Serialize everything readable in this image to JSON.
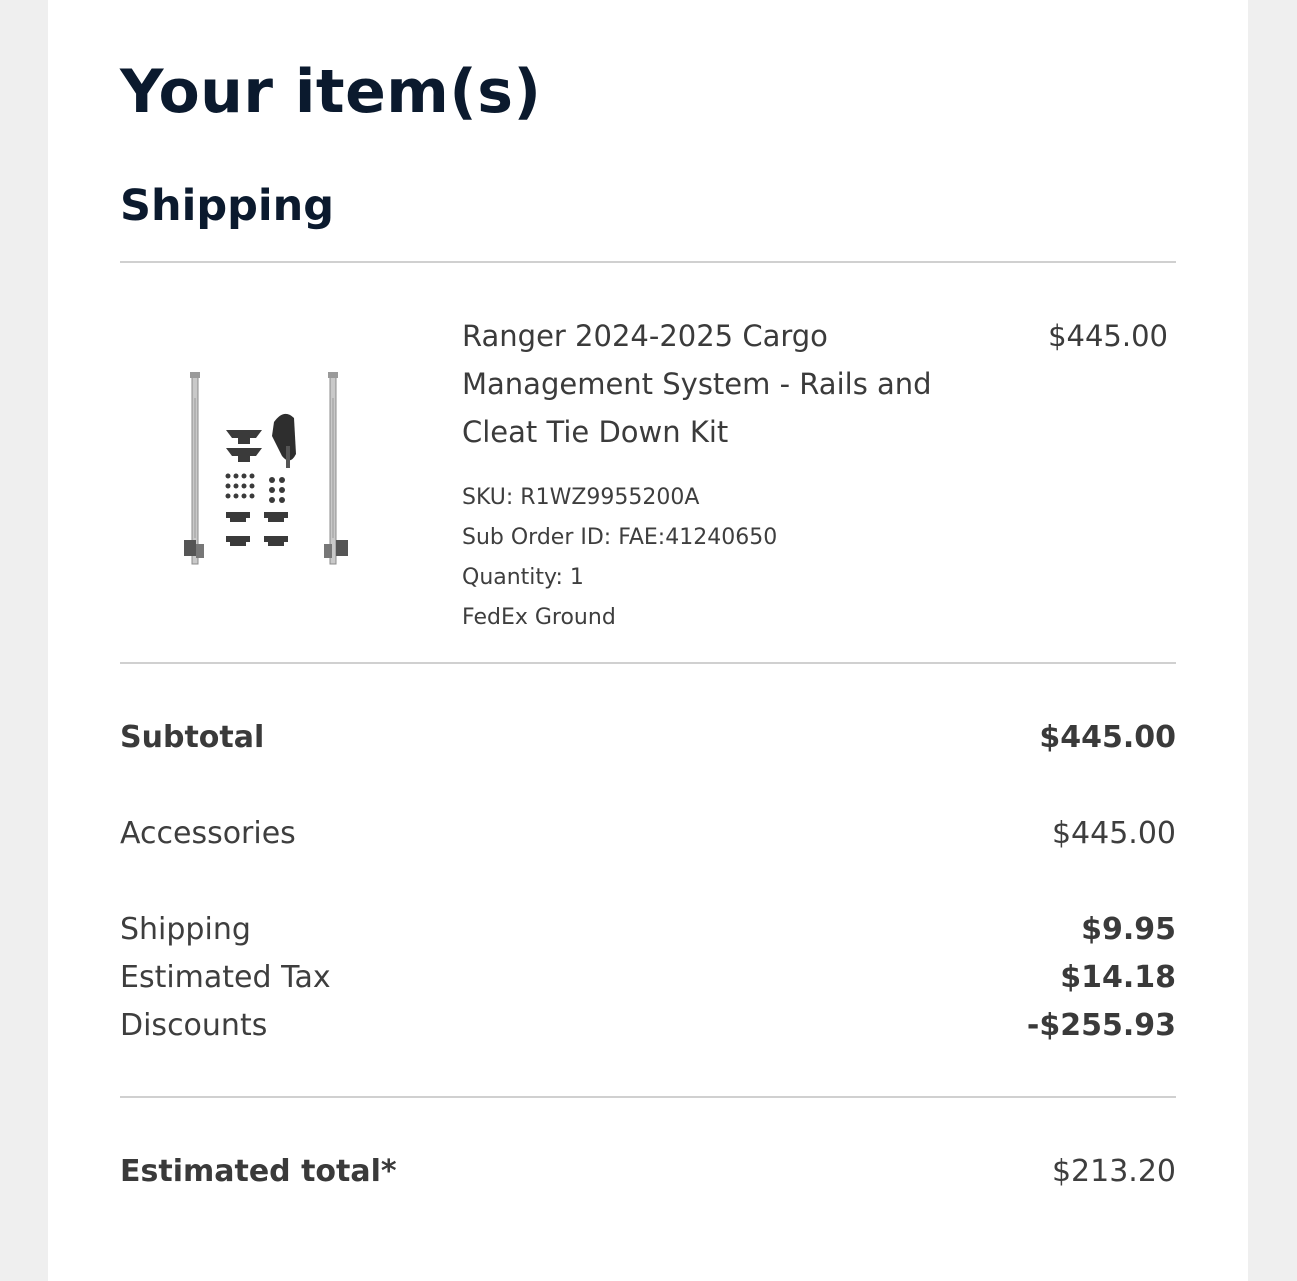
{
  "page": {
    "title": "Your item(s)",
    "section_title": "Shipping"
  },
  "item": {
    "image_alt": "Cargo management rails and cleat tie down kit",
    "name": "Ranger 2024-2025 Cargo Management System - Rails and Cleat Tie Down Kit",
    "price": "$445.00",
    "sku": "SKU: R1WZ9955200A",
    "sub_order_id": "Sub Order ID: FAE:41240650",
    "quantity": "Quantity: 1",
    "shipping_method": "FedEx Ground"
  },
  "summary": {
    "subtotal_label": "Subtotal",
    "subtotal_value": "$445.00",
    "accessories_label": "Accessories",
    "accessories_value": "$445.00",
    "shipping_label": "Shipping",
    "shipping_value": "$9.95",
    "tax_label": "Estimated Tax",
    "tax_value": "$14.18",
    "discounts_label": "Discounts",
    "discounts_value": "-$255.93",
    "total_label": "Estimated total*",
    "total_value": "$213.20"
  }
}
